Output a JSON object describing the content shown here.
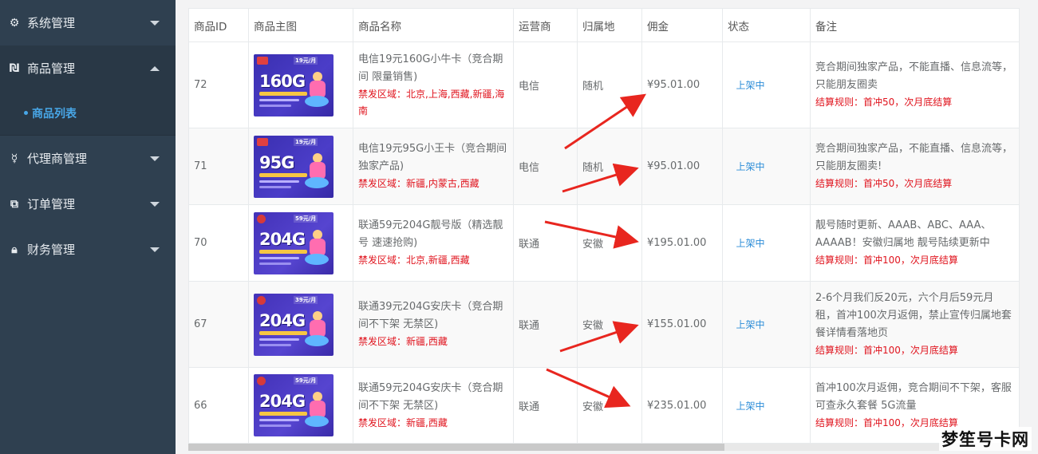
{
  "sidebar": {
    "items": [
      {
        "label": "系统管理",
        "icon": "gear-icon",
        "caret": "down"
      },
      {
        "label": "商品管理",
        "icon": "product-icon",
        "caret": "up"
      },
      {
        "label": "代理商管理",
        "icon": "agent-icon",
        "caret": "down"
      },
      {
        "label": "订单管理",
        "icon": "order-icon",
        "caret": "down"
      },
      {
        "label": "财务管理",
        "icon": "finance-icon",
        "caret": "down"
      }
    ],
    "submenu": {
      "label": "商品列表"
    }
  },
  "table": {
    "headers": [
      "商品ID",
      "商品主图",
      "商品名称",
      "运营商",
      "归属地",
      "佣金",
      "状态",
      "备注"
    ],
    "rows": [
      {
        "id": "72",
        "image": {
          "carrier": "telecom",
          "big": "160G",
          "price": "19元/月"
        },
        "name": "电信19元160G小牛卡（竞合期间 限量销售)",
        "ban": "禁发区域：北京,上海,西藏,新疆,海南",
        "operator": "电信",
        "location": "随机",
        "commission": "¥95.01.00",
        "status": "上架中",
        "note": "竞合期间独家产品，不能直播、信息流等，只能朋友圈卖",
        "rule": "结算规则：首冲50，次月底结算"
      },
      {
        "id": "71",
        "image": {
          "carrier": "telecom",
          "big": "95G",
          "price": "19元/月"
        },
        "name": "电信19元95G小王卡（竞合期间 独家产品)",
        "ban": "禁发区域：新疆,内蒙古,西藏",
        "operator": "电信",
        "location": "随机",
        "commission": "¥95.01.00",
        "status": "上架中",
        "note": "竞合期间独家产品，不能直播、信息流等，只能朋友圈卖!",
        "rule": "结算规则：首冲50，次月底结算"
      },
      {
        "id": "70",
        "image": {
          "carrier": "unicom",
          "big": "204G",
          "price": "59元/月"
        },
        "name": "联通59元204G靓号版（精选靓号 速速抢购)",
        "ban": "禁发区域：北京,新疆,西藏",
        "operator": "联通",
        "location": "安徽",
        "commission": "¥195.01.00",
        "status": "上架中",
        "note": "靓号随时更新、AAAB、ABC、AAA、AAAAB！安徽归属地 靓号陆续更新中",
        "rule": "结算规则：首冲100，次月底结算"
      },
      {
        "id": "67",
        "image": {
          "carrier": "unicom",
          "big": "204G",
          "price": "39元/月"
        },
        "name": "联通39元204G安庆卡（竞合期间不下架 无禁区)",
        "ban": "禁发区域：新疆,西藏",
        "operator": "联通",
        "location": "安徽",
        "commission": "¥155.01.00",
        "status": "上架中",
        "note": "2-6个月我们反20元，六个月后59元月租，首冲100次月返佣，禁止宣传归属地套餐详情看落地页",
        "rule": "结算规则：首冲100，次月底结算"
      },
      {
        "id": "66",
        "image": {
          "carrier": "unicom",
          "big": "204G",
          "price": "59元/月"
        },
        "name": "联通59元204G安庆卡（竞合期间不下架 无禁区)",
        "ban": "禁发区域：新疆,西藏",
        "operator": "联通",
        "location": "安徽",
        "commission": "¥235.01.00",
        "status": "上架中",
        "note": "首冲100次月返佣，竞合期间不下架，客服可查永久套餐 5G流量",
        "rule": "结算规则：首冲100，次月底结算"
      }
    ]
  },
  "watermark": "梦笙号卡网",
  "colors": {
    "sidebar_bg": "#2f4050",
    "link": "#2e8ed8",
    "warning": "#e0141e",
    "arrow": "#e8261f"
  }
}
